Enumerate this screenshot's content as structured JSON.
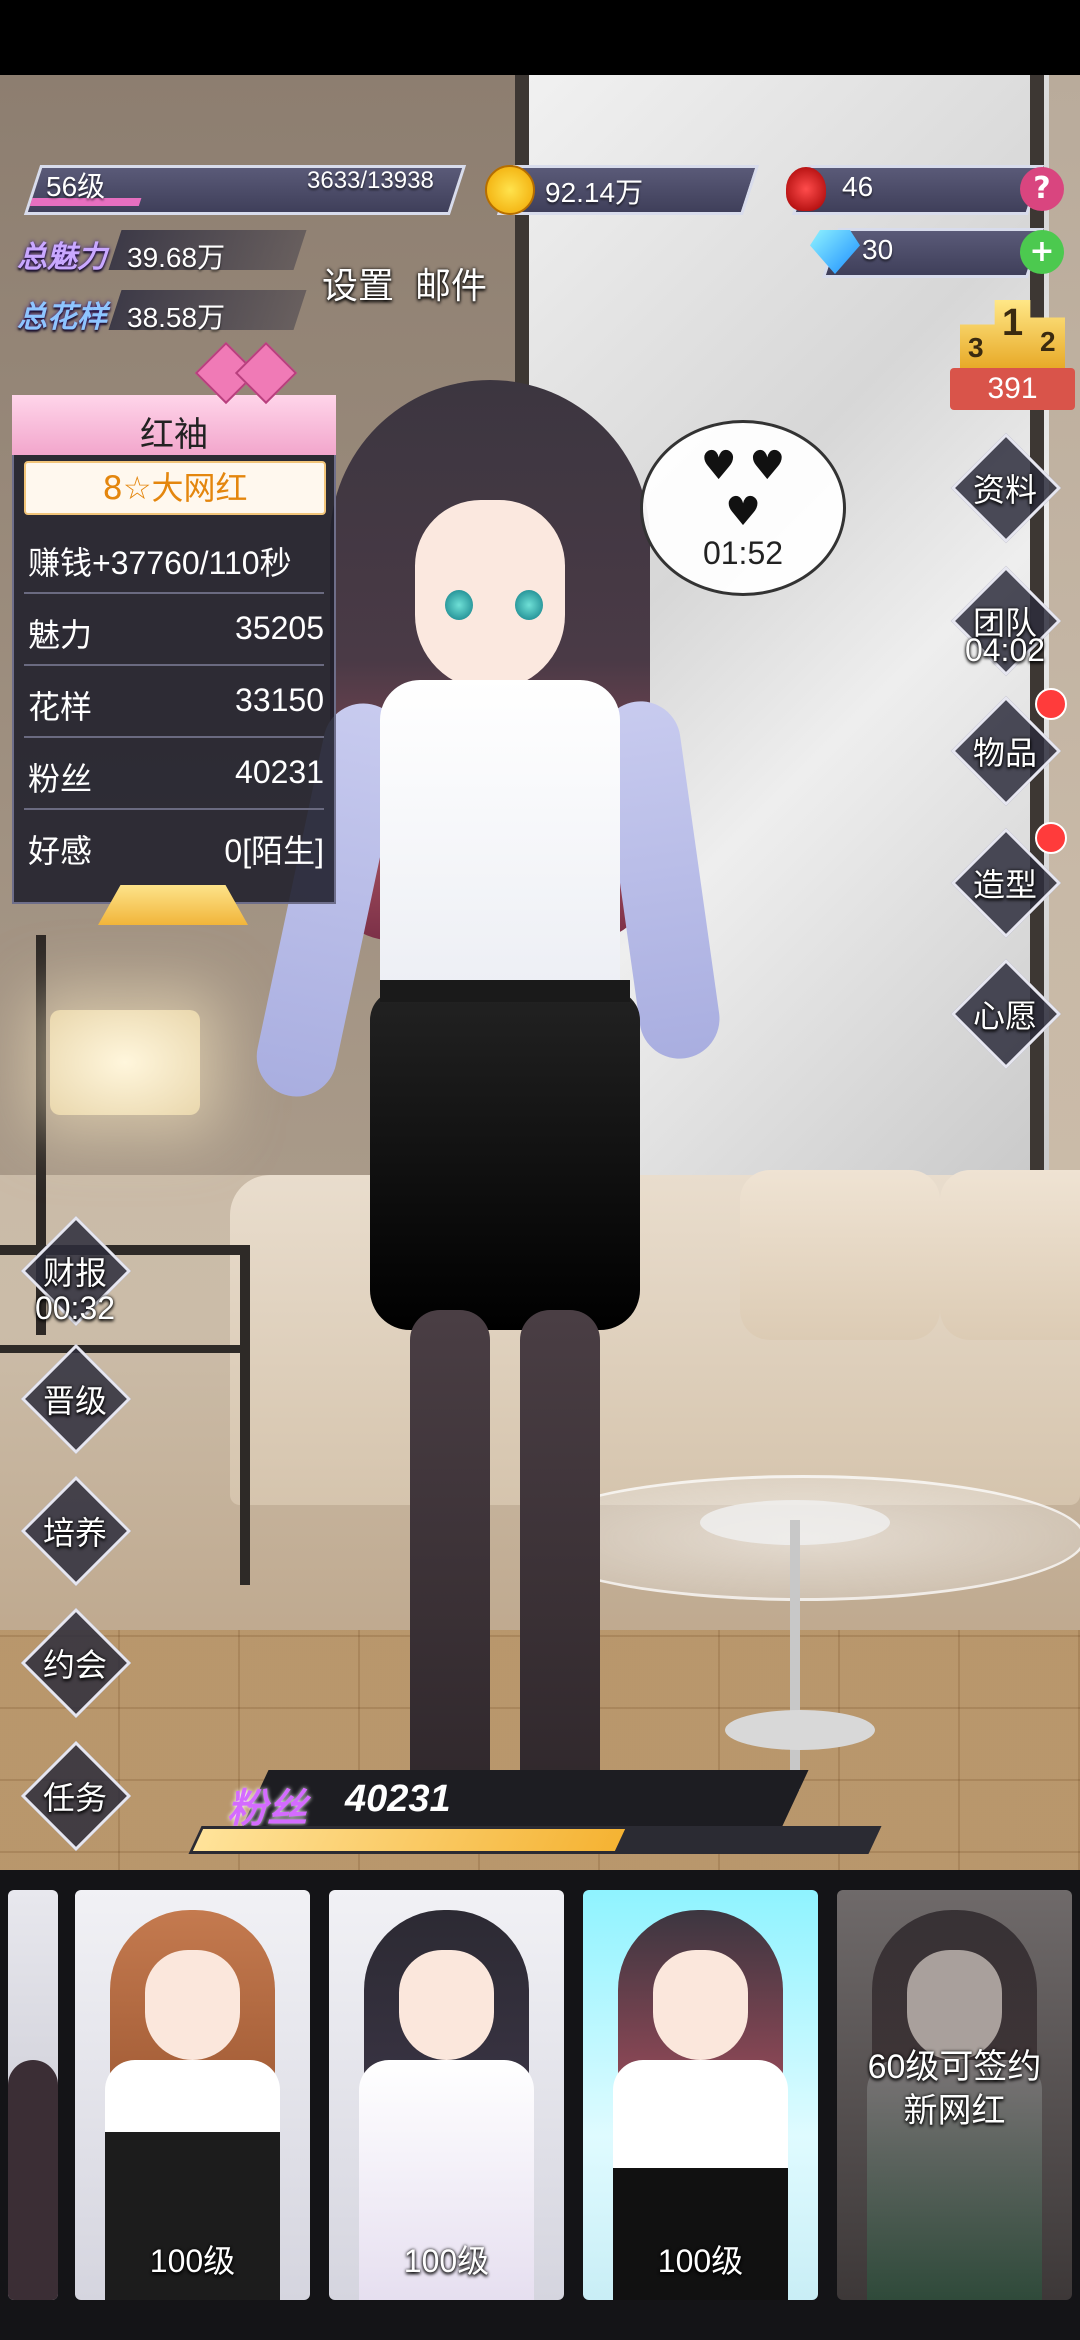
{
  "player": {
    "level_label": "56级",
    "exp_text": "3633/13938",
    "exp_progress": 0.26
  },
  "currency": {
    "coins": "92.14万",
    "roses": "46",
    "diamonds": "30",
    "help_symbol": "?",
    "add_symbol": "+"
  },
  "totals": {
    "charm_label": "总魅力",
    "charm_value": "39.68万",
    "skill_label": "总花样",
    "skill_value": "38.58万"
  },
  "top_links": {
    "settings": "设置",
    "mail": "邮件"
  },
  "ranking": {
    "left": "3",
    "center": "1",
    "right": "2",
    "value": "391"
  },
  "bubble": {
    "hearts": "♥ ♥ ♥",
    "timer": "01:52"
  },
  "info_panel": {
    "name": "红袖",
    "rank": "8☆大网红",
    "rows": [
      {
        "key": "赚钱+37760/110秒",
        "value": ""
      },
      {
        "key": "魅力",
        "value": "35205"
      },
      {
        "key": "花样",
        "value": "33150"
      },
      {
        "key": "粉丝",
        "value": "40231"
      },
      {
        "key": "好感",
        "value": "0[陌生]"
      }
    ]
  },
  "right_menu": {
    "profile": "资料",
    "team": "团队",
    "team_timer": "04:02",
    "items": "物品",
    "styling": "造型",
    "wish": "心愿"
  },
  "left_menu": {
    "report": "财报",
    "report_timer": "00:32",
    "promote": "晋级",
    "train": "培养",
    "date": "约会",
    "task": "任务"
  },
  "fans_bar": {
    "label": "粉丝",
    "value": "40231",
    "progress": 0.63
  },
  "cards": [
    {
      "level": "100级"
    },
    {
      "level": "100级"
    },
    {
      "level": "100级"
    },
    {
      "lock_line1": "60级可签约",
      "lock_line2": "新网红"
    }
  ],
  "colors": {
    "accent_pink": "#f2a6cc",
    "rank_orange": "#e4860d",
    "selected_cyan": "#8ff3ff",
    "fans_purple": "#d46bff"
  }
}
